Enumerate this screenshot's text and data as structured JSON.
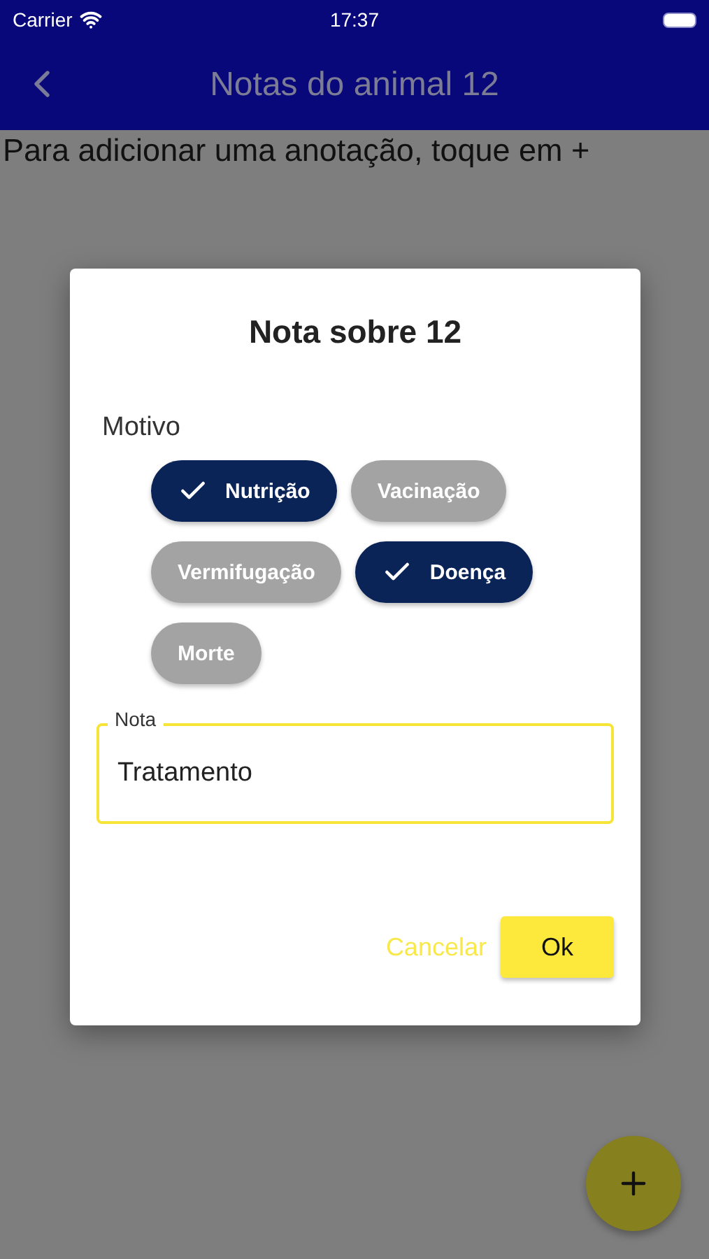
{
  "status_bar": {
    "carrier": "Carrier",
    "time": "17:37"
  },
  "app_bar": {
    "title": "Notas do animal 12"
  },
  "body": {
    "hint": "Para adicionar uma anotação, toque em +"
  },
  "dialog": {
    "title": "Nota sobre 12",
    "reason_label": "Motivo",
    "chips": [
      {
        "label": "Nutrição",
        "selected": true
      },
      {
        "label": "Vacinação",
        "selected": false
      },
      {
        "label": "Vermifugação",
        "selected": false
      },
      {
        "label": "Doença",
        "selected": true
      },
      {
        "label": "Morte",
        "selected": false
      }
    ],
    "note": {
      "label": "Nota",
      "value": "Tratamento"
    },
    "buttons": [
      {
        "label": "Cancelar",
        "kind": "text"
      },
      {
        "label": "Ok",
        "kind": "filled"
      }
    ]
  }
}
